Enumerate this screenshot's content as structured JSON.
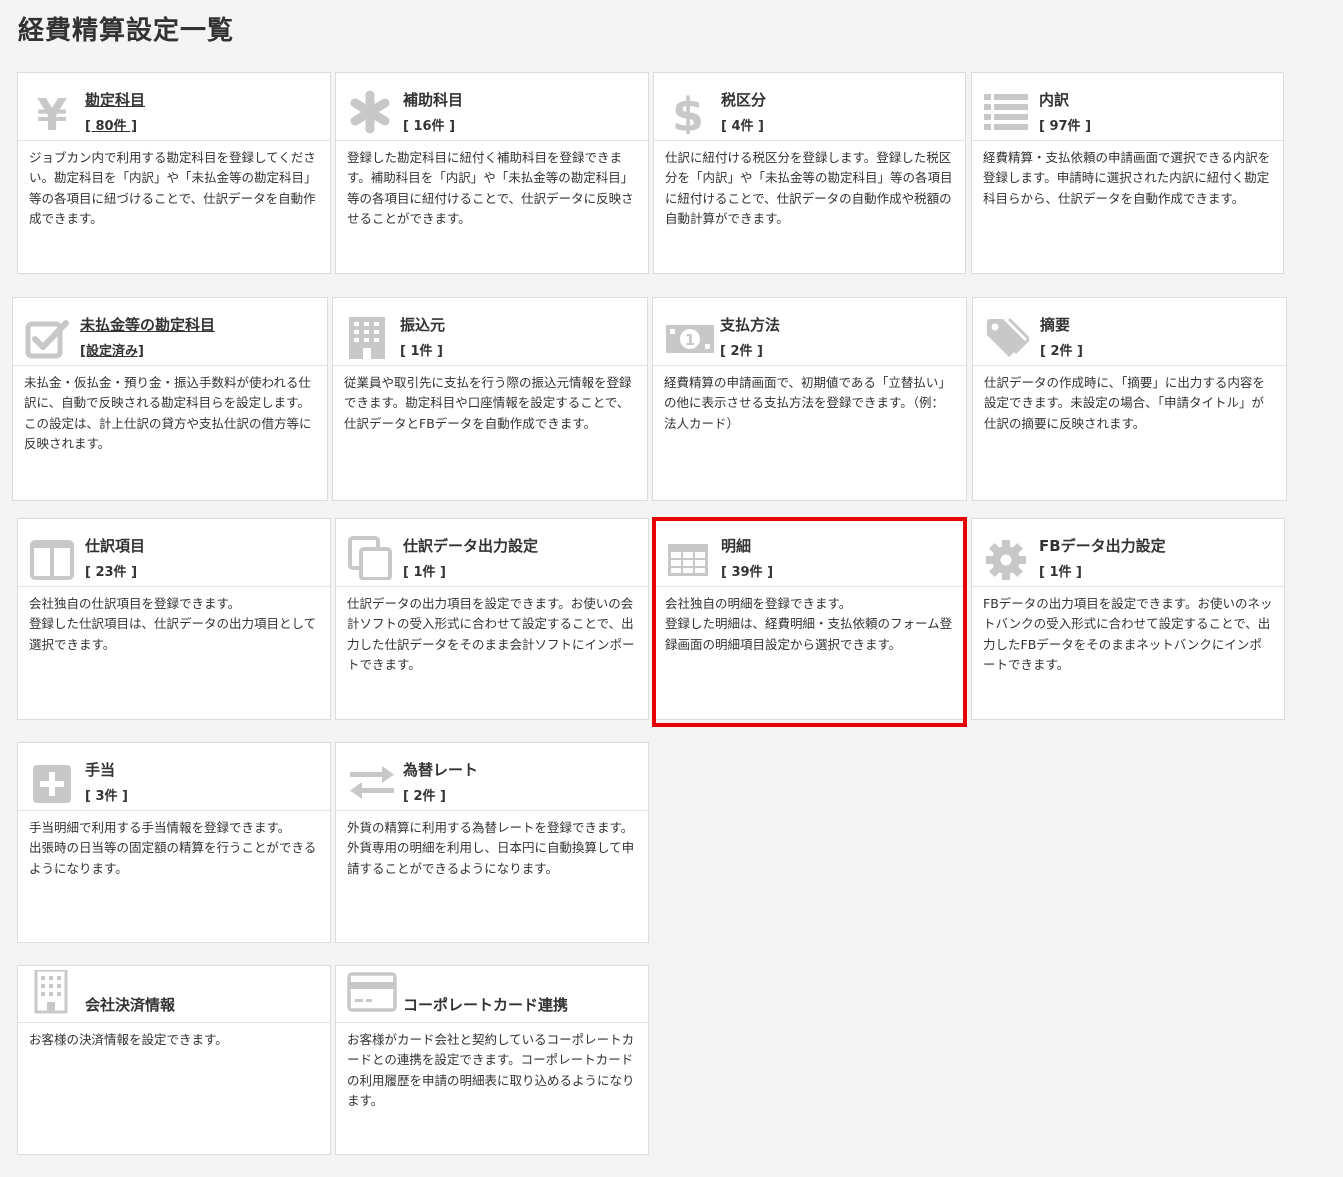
{
  "page_title": "経費精算設定一覧",
  "cards": [
    {
      "name": "勘定科目",
      "count": "[ 80件 ]",
      "icon": "yen-icon",
      "desc": "ジョブカン内で利用する勘定科目を登録してください。勘定科目を「内訳」や「未払金等の勘定科目」等の各項目に紐づけることで、仕訳データを自動作成できます。"
    },
    {
      "name": "補助科目",
      "count": "[ 16件 ]",
      "icon": "asterisk-icon",
      "desc": "登録した勘定科目に紐付く補助科目を登録できます。補助科目を「内訳」や「未払金等の勘定科目」等の各項目に紐付けることで、仕訳データに反映させることができます。"
    },
    {
      "name": "税区分",
      "count": "[ 4件 ]",
      "icon": "dollar-icon",
      "desc": "仕訳に紐付ける税区分を登録します。登録した税区分を「内訳」や「未払金等の勘定科目」等の各項目に紐付けることで、仕訳データの自動作成や税額の自動計算ができます。"
    },
    {
      "name": "内訳",
      "count": "[ 97件 ]",
      "icon": "list-icon",
      "desc": "経費精算・支払依頼の申請画面で選択できる内訳を登録します。申請時に選択された内訳に紐付く勘定科目らから、仕訳データを自動作成できます。"
    },
    {
      "name": "未払金等の勘定科目",
      "count": "[設定済み]",
      "icon": "checkbox-icon",
      "desc": "未払金・仮払金・預り金・振込手数料が使われる仕訳に、自動で反映される勘定科目らを設定します。\nこの設定は、計上仕訳の貸方や支払仕訳の借方等に反映されます。"
    },
    {
      "name": "振込元",
      "count": "[ 1件 ]",
      "icon": "building-icon",
      "desc": "従業員や取引先に支払を行う際の振込元情報を登録できます。勘定科目や口座情報を設定することで、仕訳データとFBデータを自動作成できます。"
    },
    {
      "name": "支払方法",
      "count": "[ 2件 ]",
      "icon": "money-icon",
      "desc": "経費精算の申請画面で、初期値である「立替払い」の他に表示させる支払方法を登録できます。（例：法人カード）"
    },
    {
      "name": "摘要",
      "count": "[ 2件 ]",
      "icon": "tag-icon",
      "desc": "仕訳データの作成時に、「摘要」に出力する内容を設定できます。未設定の場合、「申請タイトル」が仕訳の摘要に反映されます。"
    },
    {
      "name": "仕訳項目",
      "count": "[ 23件 ]",
      "icon": "columns-icon",
      "desc": "会社独自の仕訳項目を登録できます。\n登録した仕訳項目は、仕訳データの出力項目として選択できます。"
    },
    {
      "name": "仕訳データ出力設定",
      "count": "[ 1件 ]",
      "icon": "copy-icon",
      "desc": "仕訳データの出力項目を設定できます。お使いの会計ソフトの受入形式に合わせて設定することで、出力した仕訳データをそのまま会計ソフトにインポートできます。"
    },
    {
      "name": "明細",
      "count": "[ 39件 ]",
      "icon": "table-icon",
      "desc": "会社独自の明細を登録できます。\n登録した明細は、経費明細・支払依頼のフォーム登録画面の明細項目設定から選択できます。"
    },
    {
      "name": "FBデータ出力設定",
      "count": "[ 1件 ]",
      "icon": "gear-icon",
      "desc": "FBデータの出力項目を設定できます。お使いのネットバンクの受入形式に合わせて設定することで、出力したFBデータをそのままネットバンクにインポートできます。"
    },
    {
      "name": "手当",
      "count": "[ 3件 ]",
      "icon": "plus-icon",
      "desc": "手当明細で利用する手当情報を登録できます。\n出張時の日当等の固定額の精算を行うことができるようになります。"
    },
    {
      "name": "為替レート",
      "count": "[ 2件 ]",
      "icon": "exchange-icon",
      "desc": "外貨の精算に利用する為替レートを登録できます。外貨専用の明細を利用し、日本円に自動換算して申請することができるようになります。"
    },
    {
      "name": "会社決済情報",
      "count": "",
      "icon": "building-icon",
      "desc": "お客様の決済情報を設定できます。"
    },
    {
      "name": "コーポレートカード連携",
      "count": "",
      "icon": "credit-card-icon",
      "desc": "お客様がカード会社と契約しているコーポレートカードとの連携を設定できます。コーポレートカードの利用履歴を申請の明細表に取り込めるようになります。"
    }
  ]
}
